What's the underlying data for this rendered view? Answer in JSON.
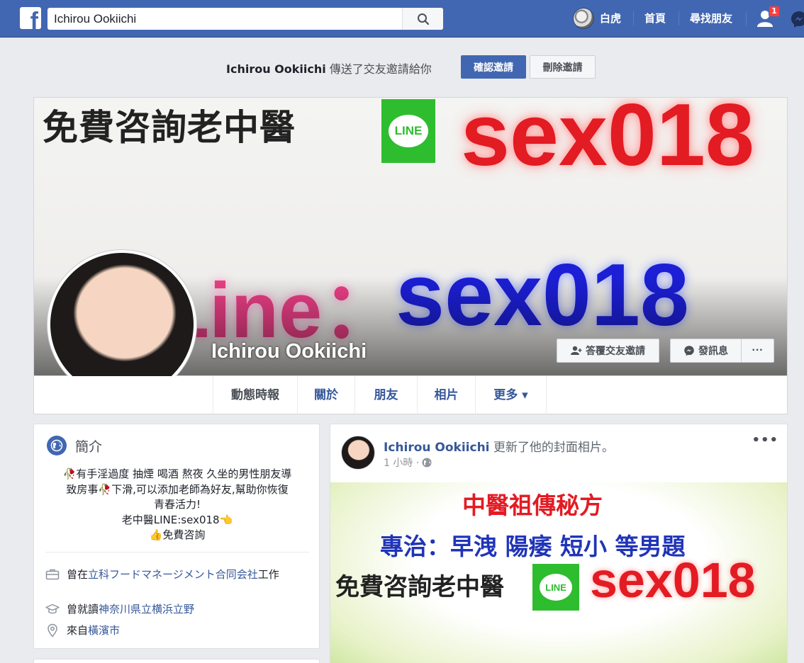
{
  "header": {
    "search_value": "Ichirou Ookiichi",
    "user_name": "白虎",
    "nav_home": "首頁",
    "nav_find_friends": "尋找朋友",
    "friend_request_count": "1",
    "logo_letter": "f",
    "brand_color": "#4267b2"
  },
  "request_bar": {
    "sender": "Ichirou Ookiichi",
    "message": " 傳送了交友邀請給你",
    "confirm_label": "確認邀請",
    "delete_label": "刪除邀請"
  },
  "cover": {
    "line1_text": "免費咨詢老中醫",
    "line_logo_text": "LINE",
    "red_id": "sex018",
    "line_label": "Line：",
    "blue_id": "sex018"
  },
  "profile": {
    "name": "Ichirou Ookiichi",
    "reply_request_label": "答覆交友邀請",
    "message_label": "發訊息",
    "more_label": "···"
  },
  "tabs": [
    {
      "label": "動態時報"
    },
    {
      "label": "關於"
    },
    {
      "label": "朋友"
    },
    {
      "label": "相片"
    },
    {
      "label": "更多 ▾"
    }
  ],
  "intro": {
    "title": "簡介",
    "bio_line1": "🥀有手淫過度 抽煙 喝酒 熬夜 久坐的男性朋友導",
    "bio_line2": "致房事🥀下滑,可以添加老師為好友,幫助你恢復",
    "bio_line3": "青春活力!",
    "bio_line4": "老中醫LINE:sex018👈",
    "bio_line5": "👍免費咨詢",
    "work_prefix": "曾在",
    "work_place": "立科フードマネージメント合同会社",
    "work_suffix": "工作",
    "school_prefix": "曾就讀",
    "school_name": "神奈川県立横浜立野",
    "from_prefix": "來自",
    "from_place": "橫濱市"
  },
  "post": {
    "author": "Ichirou Ookiichi",
    "action": " 更新了他的封面相片。",
    "time": "1 小時 ·",
    "menu": "•••",
    "img_line1": "中醫祖傳秘方",
    "img_line2": "專治：早洩 陽痿 短小 等男題",
    "img_line3": "免費咨詢老中醫",
    "img_logo": "LINE",
    "img_id": "sex018"
  }
}
